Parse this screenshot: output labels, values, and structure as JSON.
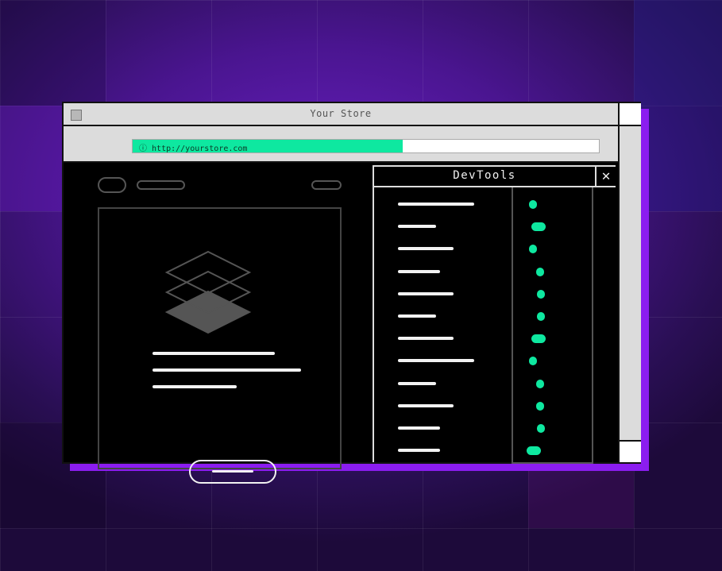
{
  "window": {
    "title": "Your Store"
  },
  "address_bar": {
    "info_icon": "info-circle-icon",
    "url": "http://yourstore.com",
    "load_progress": 0.58
  },
  "devtools": {
    "title": "DevTools",
    "close_icon": "close-x-icon",
    "row_count": 12
  },
  "colors": {
    "accent": "#0ee8a0",
    "shadow": "#8b1df0",
    "background": "#4a1590"
  }
}
